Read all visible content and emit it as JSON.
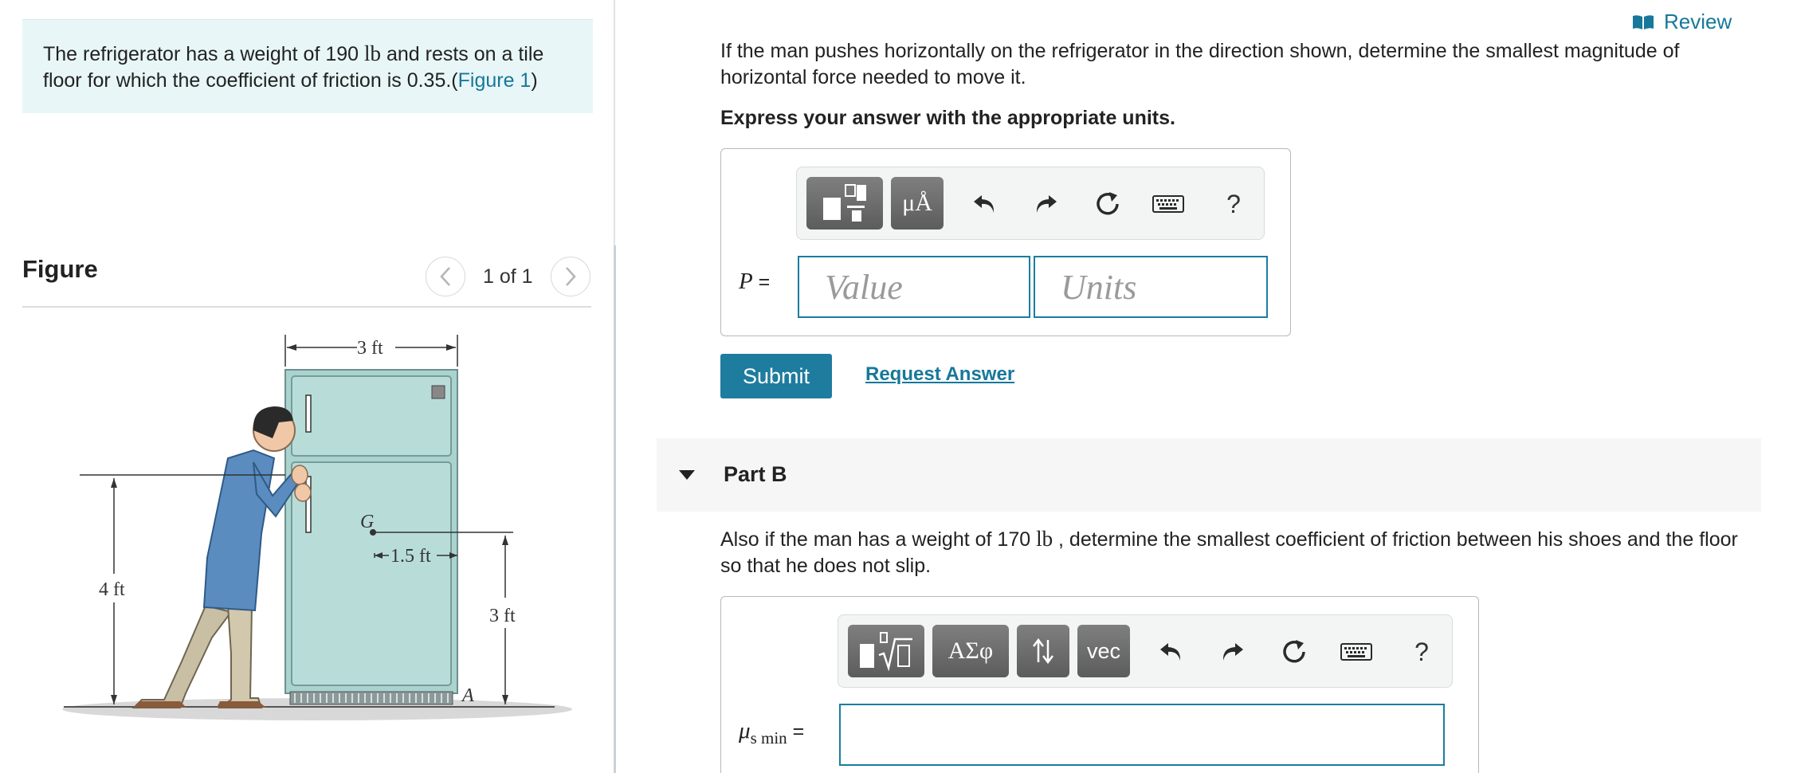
{
  "problem": {
    "text_before": "The refrigerator has a weight of 190 ",
    "unit": "lb",
    "text_after": " and rests on a tile floor for which the coefficient of friction is 0.35.(",
    "figure_link": "Figure 1",
    "text_close": ")"
  },
  "figure": {
    "title": "Figure",
    "pager": "1 of 1",
    "labels": {
      "width": "3 ft",
      "g": "G",
      "offset": "1.5 ft",
      "left_height": "4 ft",
      "right_height": "3 ft",
      "corner": "A"
    }
  },
  "review": {
    "label": "Review",
    "icon": "book-icon"
  },
  "partA": {
    "question": "If the man pushes horizontally on the refrigerator in the direction shown, determine the smallest magnitude of horizontal force needed to move it.",
    "instruction": "Express your answer with the appropriate units.",
    "toolbar": {
      "units_button": "μÅ",
      "help": "?"
    },
    "var_label": "P",
    "var_eq": " =",
    "value_placeholder": "Value",
    "units_placeholder": "Units",
    "submit": "Submit",
    "request": "Request Answer"
  },
  "partB": {
    "title": "Part B",
    "question_before": "Also if the man has a weight of 170 ",
    "unit": "lb",
    "question_after": " , determine the smallest coefficient of friction between his shoes and the floor so that he does not slip.",
    "toolbar": {
      "greek_button": "ΑΣφ",
      "vec_button": "vec",
      "help": "?"
    },
    "var_label": "μ",
    "var_sub": "s min",
    "var_eq": " ="
  },
  "colors": {
    "accent": "#1e7c9e",
    "link": "#16789a",
    "problem_bg": "#e8f6f7",
    "fridge": "#a9d3cf"
  }
}
